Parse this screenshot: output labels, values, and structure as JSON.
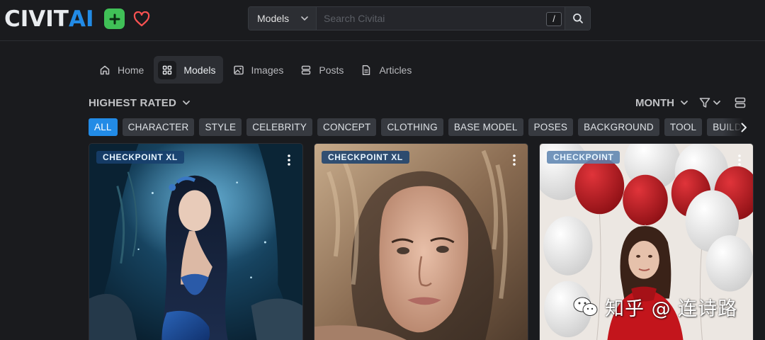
{
  "header": {
    "logo_part1": "CIVIT",
    "logo_part2": "AI",
    "search": {
      "type_label": "Models",
      "placeholder": "Search Civitai",
      "shortcut_key": "/"
    }
  },
  "nav": {
    "items": [
      {
        "label": "Home",
        "icon": "home-icon"
      },
      {
        "label": "Models",
        "icon": "grid-icon",
        "active": true
      },
      {
        "label": "Images",
        "icon": "image-icon"
      },
      {
        "label": "Posts",
        "icon": "posts-icon"
      },
      {
        "label": "Articles",
        "icon": "article-icon"
      }
    ]
  },
  "sort": {
    "label": "HIGHEST RATED"
  },
  "period": {
    "label": "MONTH"
  },
  "categories": [
    "ALL",
    "CHARACTER",
    "STYLE",
    "CELEBRITY",
    "CONCEPT",
    "CLOTHING",
    "BASE MODEL",
    "POSES",
    "BACKGROUND",
    "TOOL",
    "BUILDINGS"
  ],
  "cards": [
    {
      "badge": "CHECKPOINT XL",
      "image": "mermaid portrait"
    },
    {
      "badge": "CHECKPOINT XL",
      "image": "curly haired woman portrait"
    },
    {
      "badge": "CHECKPOINT",
      "image": "woman with red and white balloons"
    }
  ],
  "watermark": {
    "text": "知乎 @ 连诗路"
  },
  "colors": {
    "background": "#1a1b1e",
    "accent": "#228be6",
    "plus_button": "#40c057",
    "heart": "#fa5252"
  }
}
